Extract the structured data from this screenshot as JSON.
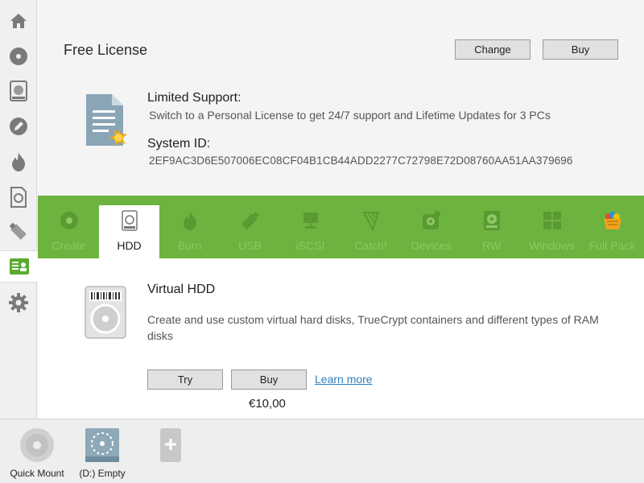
{
  "sidebar": {
    "items": [
      {
        "icon": "home-icon"
      },
      {
        "icon": "disc-icon"
      },
      {
        "icon": "hdd-icon"
      },
      {
        "icon": "pen-icon"
      },
      {
        "icon": "flame-icon"
      },
      {
        "icon": "image-file-icon"
      },
      {
        "icon": "usb-icon"
      },
      {
        "icon": "license-icon",
        "active": true
      },
      {
        "icon": "gear-icon"
      }
    ]
  },
  "license": {
    "title": "Free License",
    "change_label": "Change",
    "buy_label": "Buy",
    "support_heading": "Limited Support:",
    "support_text": "Switch to a Personal License to get 24/7 support and Lifetime Updates for 3 PCs",
    "system_id_heading": "System ID:",
    "system_id": "2EF9AC3D6E507006EC08CF04B1CB44ADD2277C72798E72D08760AA51AA379696"
  },
  "tabs": [
    {
      "label": "Create",
      "icon": "disc-icon"
    },
    {
      "label": "HDD",
      "icon": "hdd-icon",
      "active": true
    },
    {
      "label": "Burn",
      "icon": "flame-icon"
    },
    {
      "label": "USB",
      "icon": "usb-icon"
    },
    {
      "label": "iSCSI",
      "icon": "network-icon"
    },
    {
      "label": "Catch!",
      "icon": "catch-icon"
    },
    {
      "label": "Devices",
      "icon": "devices-icon"
    },
    {
      "label": "RW",
      "icon": "rw-icon"
    },
    {
      "label": "Windows",
      "icon": "windows-icon"
    },
    {
      "label": "Full Pack",
      "icon": "basket-icon"
    }
  ],
  "product": {
    "title": "Virtual HDD",
    "description": "Create and use custom virtual hard disks, TrueCrypt containers and different types of RAM disks",
    "try_label": "Try",
    "buy_label": "Buy",
    "learn_more": "Learn more",
    "price": "€10,00"
  },
  "bottom": {
    "drives": [
      {
        "label": "Quick Mount",
        "icon": "quick-mount-icon"
      },
      {
        "label": "(D:) Empty",
        "icon": "virtual-drive-icon"
      },
      {
        "label": "",
        "icon": "add-device-icon"
      }
    ]
  },
  "colors": {
    "tab_green": "#6db33f",
    "tab_inactive_text": "#8dc965",
    "link_blue": "#2f7fc1",
    "sidebar_green": "#5aab2e"
  }
}
